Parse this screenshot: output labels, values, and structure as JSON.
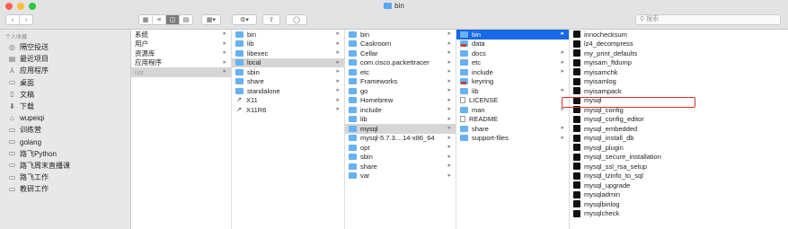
{
  "window": {
    "title": "bin",
    "search_placeholder": "搜索"
  },
  "colors": {
    "close": "#fe5f57",
    "minimize": "#febc2e",
    "zoom": "#28c840",
    "selection": "#1769e6",
    "folder": "#68b1f2",
    "highlight_box": "#d93025"
  },
  "toolbar": {
    "back_icon": "chevron-left-icon",
    "forward_icon": "chevron-right-icon",
    "view_icons": [
      "icon-view-icon",
      "list-view-icon",
      "column-view-icon",
      "gallery-view-icon"
    ],
    "group_icon": "group-icon",
    "action_icon": "gear-icon",
    "share_icon": "share-icon",
    "tag_icon": "tag-icon"
  },
  "sidebar": {
    "section": "个人收藏",
    "items": [
      {
        "label": "隔空投送",
        "icon": "airdrop-icon"
      },
      {
        "label": "最近项目",
        "icon": "recents-icon"
      },
      {
        "label": "应用程序",
        "icon": "applications-icon"
      },
      {
        "label": "桌面",
        "icon": "desktop-icon"
      },
      {
        "label": "文稿",
        "icon": "documents-icon"
      },
      {
        "label": "下载",
        "icon": "downloads-icon"
      },
      {
        "label": "wupeiqi",
        "icon": "home-icon"
      },
      {
        "label": "训练营",
        "icon": "folder-icon"
      },
      {
        "label": "golang",
        "icon": "folder-icon"
      },
      {
        "label": "路飞Python",
        "icon": "folder-icon"
      },
      {
        "label": "路飞周末直播课",
        "icon": "folder-icon"
      },
      {
        "label": "路飞工作",
        "icon": "folder-icon"
      },
      {
        "label": "教研工作",
        "icon": "folder-icon"
      }
    ]
  },
  "columns": [
    {
      "items": [
        {
          "label": "系统",
          "icon": "none",
          "chevron": true
        },
        {
          "label": "用户",
          "icon": "none",
          "chevron": true
        },
        {
          "label": "资源库",
          "icon": "none",
          "chevron": true
        },
        {
          "label": "应用程序",
          "icon": "none",
          "chevron": true
        },
        {
          "label": "usr",
          "icon": "none",
          "chevron": true,
          "state": "sel-gray muted"
        }
      ]
    },
    {
      "items": [
        {
          "label": "bin",
          "icon": "folder",
          "chevron": true
        },
        {
          "label": "lib",
          "icon": "folder",
          "chevron": true
        },
        {
          "label": "libexec",
          "icon": "folder",
          "chevron": true
        },
        {
          "label": "local",
          "icon": "folder",
          "chevron": true,
          "state": "sel-gray"
        },
        {
          "label": "sbin",
          "icon": "folder",
          "chevron": true
        },
        {
          "label": "share",
          "icon": "folder",
          "chevron": true
        },
        {
          "label": "standalone",
          "icon": "folder",
          "chevron": true
        },
        {
          "label": "X11",
          "icon": "link",
          "chevron": true
        },
        {
          "label": "X11R6",
          "icon": "link",
          "chevron": true
        }
      ]
    },
    {
      "items": [
        {
          "label": "bin",
          "icon": "folder",
          "chevron": true
        },
        {
          "label": "Caskroom",
          "icon": "folder",
          "chevron": true
        },
        {
          "label": "Cellar",
          "icon": "folder",
          "chevron": true
        },
        {
          "label": "com.cisco.packettracer",
          "icon": "folder",
          "chevron": true
        },
        {
          "label": "etc",
          "icon": "folder",
          "chevron": true
        },
        {
          "label": "Frameworks",
          "icon": "folder",
          "chevron": true
        },
        {
          "label": "go",
          "icon": "folder",
          "chevron": true
        },
        {
          "label": "Homebrew",
          "icon": "folder",
          "chevron": true
        },
        {
          "label": "include",
          "icon": "folder",
          "chevron": true
        },
        {
          "label": "lib",
          "icon": "folder",
          "chevron": true
        },
        {
          "label": "mysql",
          "icon": "folder",
          "chevron": true,
          "state": "sel-gray"
        },
        {
          "label": "mysql-5.7.3....14-x86_64",
          "icon": "folder",
          "chevron": true
        },
        {
          "label": "opt",
          "icon": "folder",
          "chevron": true
        },
        {
          "label": "sbin",
          "icon": "folder",
          "chevron": true
        },
        {
          "label": "share",
          "icon": "folder",
          "chevron": true
        },
        {
          "label": "var",
          "icon": "folder",
          "chevron": true
        }
      ]
    },
    {
      "items": [
        {
          "label": "bin",
          "icon": "folder",
          "chevron": true,
          "state": "sel"
        },
        {
          "label": "data",
          "icon": "red",
          "chevron": false
        },
        {
          "label": "docs",
          "icon": "folder",
          "chevron": true
        },
        {
          "label": "etc",
          "icon": "folder",
          "chevron": true
        },
        {
          "label": "include",
          "icon": "folder",
          "chevron": true
        },
        {
          "label": "keyring",
          "icon": "red",
          "chevron": false
        },
        {
          "label": "lib",
          "icon": "folder",
          "chevron": true
        },
        {
          "label": "LICENSE",
          "icon": "doc",
          "chevron": false
        },
        {
          "label": "man",
          "icon": "folder",
          "chevron": true
        },
        {
          "label": "README",
          "icon": "doc",
          "chevron": false
        },
        {
          "label": "share",
          "icon": "folder",
          "chevron": true
        },
        {
          "label": "support-files",
          "icon": "folder",
          "chevron": true
        }
      ]
    },
    {
      "items": [
        {
          "label": "innochecksum",
          "icon": "exec"
        },
        {
          "label": "lz4_decompress",
          "icon": "exec"
        },
        {
          "label": "my_print_defaults",
          "icon": "exec"
        },
        {
          "label": "myisam_ftdump",
          "icon": "exec"
        },
        {
          "label": "myisamchk",
          "icon": "exec"
        },
        {
          "label": "myisamlog",
          "icon": "exec"
        },
        {
          "label": "myisampack",
          "icon": "exec"
        },
        {
          "label": "mysql",
          "icon": "exec",
          "state": "boxed"
        },
        {
          "label": "mysql_config",
          "icon": "exec"
        },
        {
          "label": "mysql_config_editor",
          "icon": "exec"
        },
        {
          "label": "mysql_embedded",
          "icon": "exec"
        },
        {
          "label": "mysql_install_db",
          "icon": "exec"
        },
        {
          "label": "mysql_plugin",
          "icon": "exec"
        },
        {
          "label": "mysql_secure_installation",
          "icon": "exec"
        },
        {
          "label": "mysql_ssl_rsa_setup",
          "icon": "exec"
        },
        {
          "label": "mysql_tzinfo_to_sql",
          "icon": "exec"
        },
        {
          "label": "mysql_upgrade",
          "icon": "exec"
        },
        {
          "label": "mysqladmin",
          "icon": "exec"
        },
        {
          "label": "mysqlbinlog",
          "icon": "exec"
        },
        {
          "label": "mysqlcheck",
          "icon": "exec"
        }
      ]
    }
  ]
}
